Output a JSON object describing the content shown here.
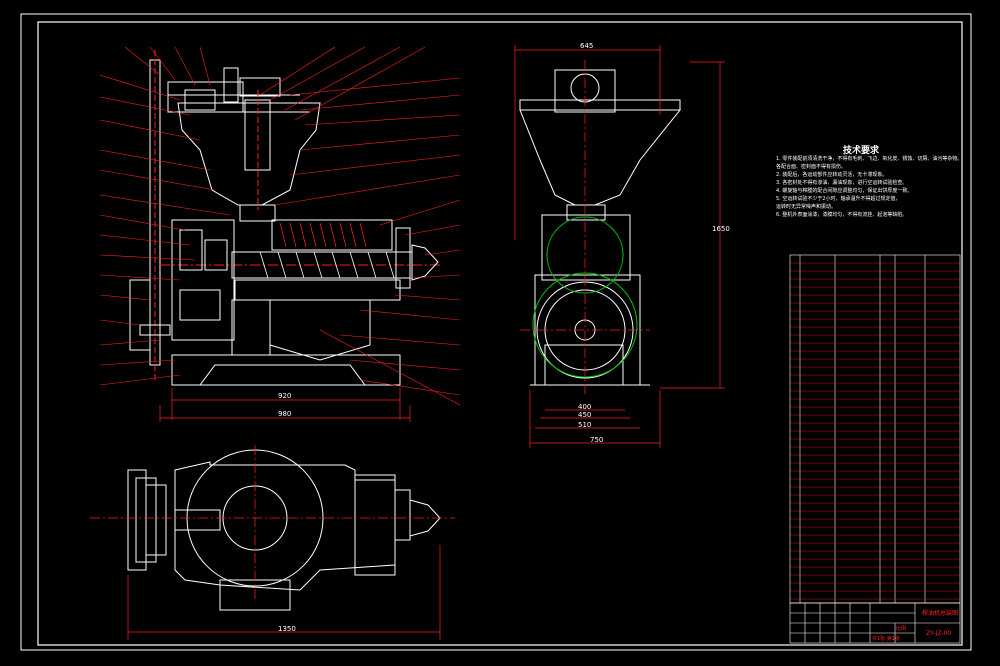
{
  "drawing": {
    "title_block": {
      "drawing_name": "榨油机总装图",
      "drawing_number": "ZY-JZ-00",
      "scale_label": "比例",
      "sheet_label": "共1张 第1张"
    },
    "dimensions": {
      "front_width_inner": "920",
      "front_width_outer": "980",
      "side_top": "645",
      "side_height": "1650",
      "side_base1": "400",
      "side_base2": "450",
      "side_base3": "510",
      "side_base4": "750",
      "plan_length": "1350"
    },
    "tech_requirements": {
      "title": "技术要求",
      "lines": [
        "1. 零件装配前须清洗干净，不得有毛刺、飞边、氧化皮、锈蚀、切屑、油污等杂物。",
        "   各配合面、密封面不得有损伤。",
        "2. 装配后，各运动部件应转动灵活，无卡滞现象。",
        "3. 各密封处不得有渗油、漏油现象，进行空运转试验检查。",
        "4. 螺旋轴与榨膛的配合间隙应调整均匀，保证出饼厚度一致。",
        "5. 空运转试验不少于2小时，轴承温升不得超过规定值，",
        "   运转时无异常噪声和振动。",
        "6. 整机外表面涂漆，漆膜均匀，不得有流挂、起泡等缺陷。"
      ]
    },
    "colors": {
      "outline": "#ffffff",
      "annotation": "#ff2020",
      "centerline": "#ff2020",
      "hidden_circle": "#00c000",
      "frame": "#ffffff"
    }
  }
}
